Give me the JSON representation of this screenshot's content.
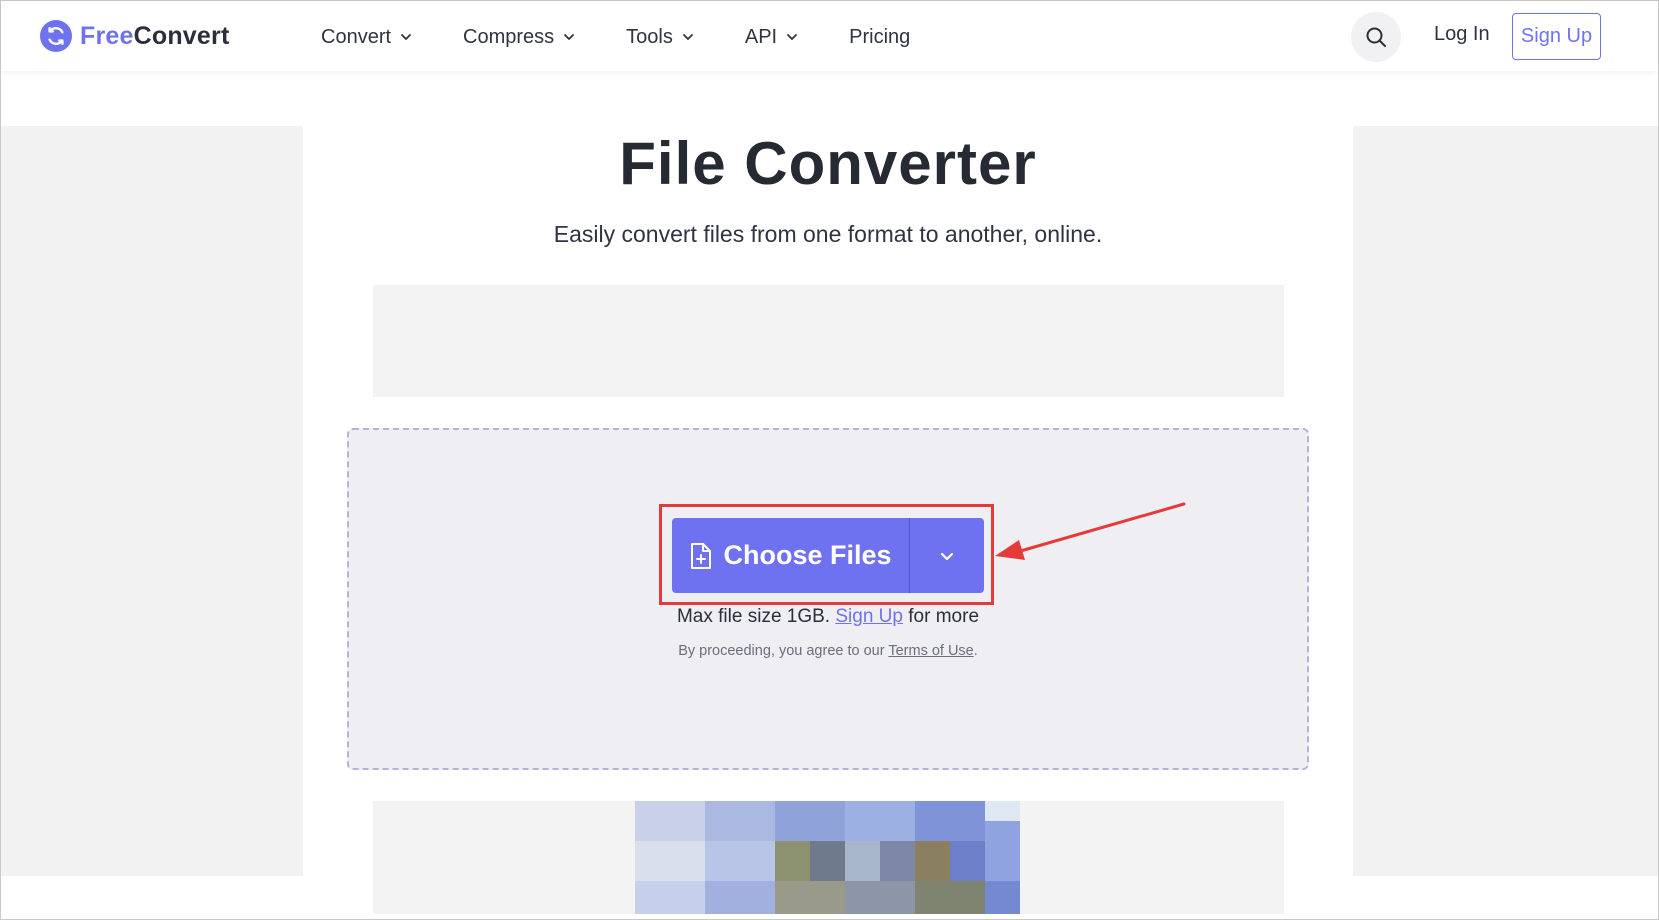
{
  "brand": {
    "name_part1": "Free",
    "name_part2": "Convert",
    "accent": "#6f72f0"
  },
  "nav": {
    "items": [
      {
        "label": "Convert"
      },
      {
        "label": "Compress"
      },
      {
        "label": "Tools"
      },
      {
        "label": "API"
      },
      {
        "label": "Pricing"
      }
    ]
  },
  "header": {
    "login_label": "Log In",
    "signup_label": "Sign Up"
  },
  "main": {
    "title": "File Converter",
    "subtitle": "Easily convert files from one format to another, online."
  },
  "upload": {
    "button_label": "Choose Files",
    "max_size_prefix": "Max file size 1GB.",
    "max_size_link": "Sign Up",
    "max_size_suffix": "for more",
    "terms_prefix": "By proceeding, you agree to our",
    "terms_link": "Terms of Use",
    "terms_suffix": "."
  },
  "annotation": {
    "highlight_color": "#e53b38"
  },
  "icons": [
    "logo-sync-icon",
    "chevron-down-icon",
    "search-icon",
    "file-add-icon"
  ]
}
